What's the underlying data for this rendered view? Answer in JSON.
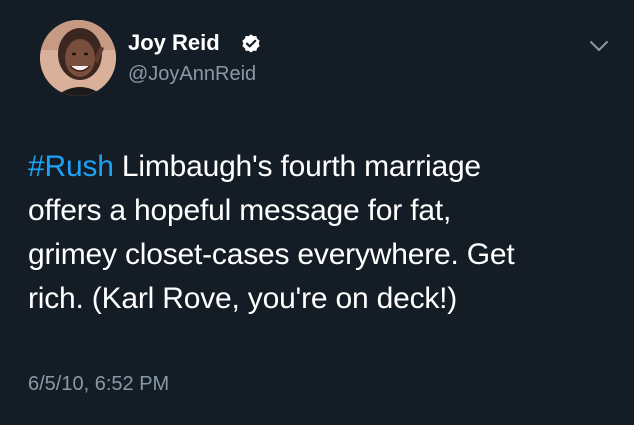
{
  "author": {
    "display_name": "Joy Reid",
    "username": "@JoyAnnReid",
    "verified_icon": "verified-badge-icon",
    "avatar_icon": "avatar"
  },
  "menu": {
    "icon": "chevron-down-icon"
  },
  "tweet": {
    "hashtag": "#Rush",
    "text_lines": [
      " Limbaugh's fourth marriage",
      "offers a hopeful message for fat,",
      "grimey closet-cases everywhere. Get",
      "rich. (Karl Rove, you're on deck!)"
    ],
    "timestamp": "6/5/10, 6:52 PM"
  },
  "colors": {
    "background": "#141d26",
    "text": "#ffffff",
    "secondary_text": "#8899a6",
    "link": "#1da1f2"
  }
}
